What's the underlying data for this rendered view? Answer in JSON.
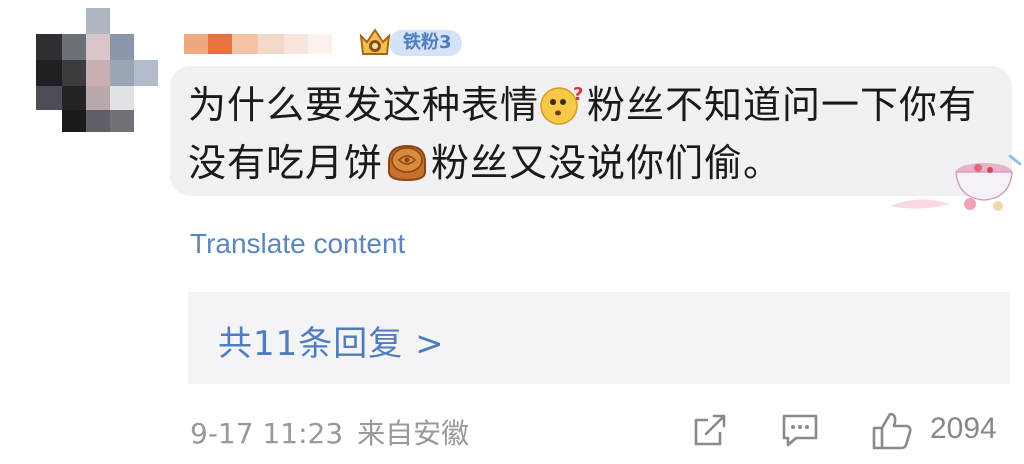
{
  "comment": {
    "fan_badge": {
      "label": "铁粉3",
      "color": "#4f7dbf",
      "icon": "crown-badge-icon"
    },
    "text_part1": "为什么要发这种表情",
    "emoji1": "confused-face-emoji",
    "text_part2": "粉丝不知道问一下你有没有吃月饼",
    "emoji2": "mooncake-emoji",
    "text_part3": "粉丝又没说你们偷。",
    "translate_label": "Translate content",
    "replies_label": "共11条回复 >",
    "timestamp": "9-17 11:23",
    "source": "来自安徽",
    "like_count": "2094",
    "link_color": "#5b86bd"
  }
}
